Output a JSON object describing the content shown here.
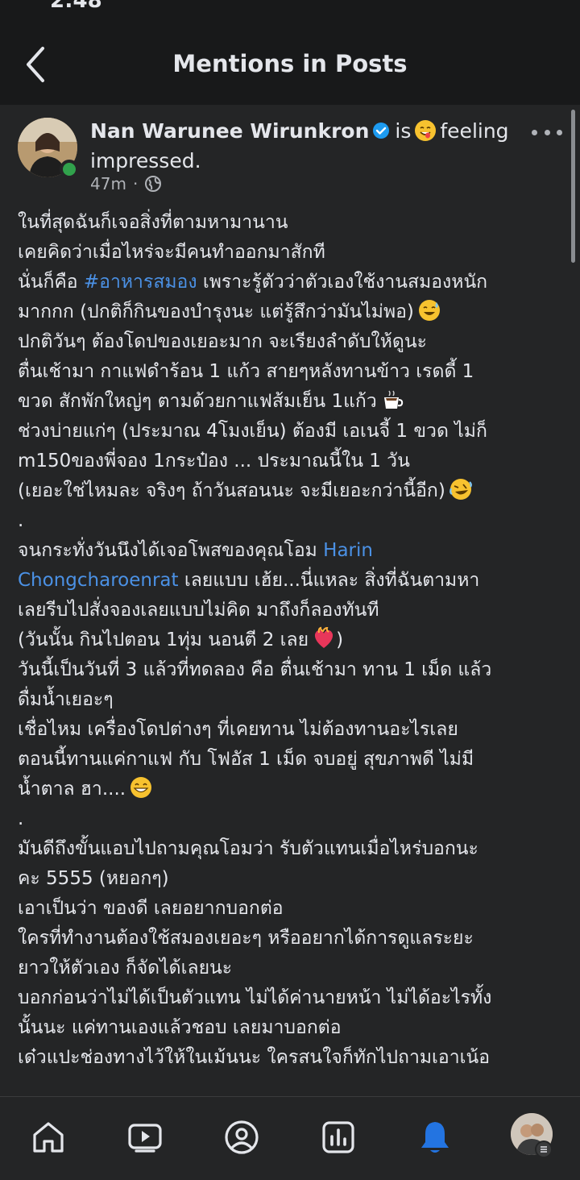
{
  "status_bar": {
    "time": "2:48"
  },
  "header": {
    "title": "Mentions in Posts",
    "back_icon": "chevron-left-icon"
  },
  "post": {
    "author": "Nan Warunee Wirunkron",
    "verified": true,
    "feeling_prefix": "is",
    "feeling_text": "feeling",
    "feeling_value": "impressed.",
    "time_ago": "47m",
    "separator": "·",
    "privacy_icon": "globe-icon",
    "more_icon": "more-horizontal-icon",
    "lines": [
      [
        {
          "t": "ในที่สุดฉันก็เจอสิ่งที่ตามหามานาน"
        }
      ],
      [
        {
          "t": "เคยคิดว่าเมื่อไหร่จะมีคนทำออกมาสักที"
        }
      ],
      [
        {
          "t": " นั่นก็คือ "
        },
        {
          "t": "#อาหารสมอง",
          "link": true
        },
        {
          "t": " เพราะรู้ตัวว่าตัวเองใช้งานสมองหนัก"
        }
      ],
      [
        {
          "t": "มากกก (ปกติก็กินของบำรุงนะ แต่รู้สึกว่ามันไม่พอ)"
        },
        {
          "emoji": "sweat-smile"
        }
      ],
      [
        {
          "t": "ปกติวันๆ ต้องโดปของเยอะมาก จะเรียงลำดับให้ดูนะ"
        }
      ],
      [
        {
          "t": "ตื่นเช้ามา กาแฟดำร้อน 1 แก้ว  สายๆหลังทานข้าว เรดดี้ 1"
        }
      ],
      [
        {
          "t": "ขวด สักพักใหญ่ๆ ตามด้วยกาแฟส้มเย็น 1แก้ว"
        },
        {
          "emoji": "coffee"
        }
      ],
      [
        {
          "t": "ช่วงบ่ายแก่ๆ (ประมาณ 4โมงเย็น) ต้องมี เอเนจี้ 1 ขวด ไม่ก็"
        }
      ],
      [
        {
          "t": "m150ของพี่จอง 1กระป๋อง ... ประมาณนี้ใน 1 วัน"
        }
      ],
      [
        {
          "t": "(เยอะใช่ไหมละ จริงๆ ถ้าวันสอนนะ จะมีเยอะกว่านี้อีก)"
        },
        {
          "emoji": "rofl"
        }
      ],
      [
        {
          "t": "."
        }
      ],
      [
        {
          "t": "จนกระทั่งวันนึงได้เจอโพสของคุณโอม "
        },
        {
          "t": "Harin",
          "link": true
        }
      ],
      [
        {
          "t": "Chongcharoenrat",
          "link": true
        },
        {
          "t": " เลยแบบ เฮ้ย...นี่แหละ สิ่งที่ฉันตามหา"
        }
      ],
      [
        {
          "t": "เลยรีบไปสั่งจองเลยแบบไม่คิด มาถึงก็ลองทันที"
        }
      ],
      [
        {
          "t": "(วันนั้น กินไปตอน 1ทุ่ม นอนตี 2 เลย"
        },
        {
          "emoji": "heart-fire"
        },
        {
          "t": ")"
        }
      ],
      [
        {
          "t": "วันนี้เป็นวันที่ 3 แล้วที่ทดลอง คือ ตื่นเช้ามา ทาน 1 เม็ด แล้ว"
        }
      ],
      [
        {
          "t": "ดื่มน้ำเยอะๆ"
        }
      ],
      [
        {
          "t": "เชื่อไหม เครื่องโดปต่างๆ ที่เคยทาน ไม่ต้องทานอะไรเลย"
        }
      ],
      [
        {
          "t": "ตอนนี้ทานแค่กาแฟ กับ โฟอัส 1 เม็ด จบอยู่ สุขภาพดี ไม่มี"
        }
      ],
      [
        {
          "t": "น้ำตาล ฮา...."
        },
        {
          "emoji": "grin"
        }
      ],
      [
        {
          "t": "."
        }
      ],
      [
        {
          "t": "มันดีถึงขั้นแอบไปถามคุณโอมว่า รับตัวแทนเมื่อไหร่บอกนะ"
        }
      ],
      [
        {
          "t": "คะ 5555 (หยอกๆ)"
        }
      ],
      [
        {
          "t": "เอาเป็นว่า ของดี เลยอยากบอกต่อ"
        }
      ],
      [
        {
          "t": "ใครที่ทำงานต้องใช้สมองเยอะๆ หรืออยากได้การดูแลระยะ"
        }
      ],
      [
        {
          "t": "ยาวให้ตัวเอง ก็จัดได้เลยนะ"
        }
      ],
      [
        {
          "t": "บอกก่อนว่าไม่ได้เป็นตัวแทน ไม่ได้ค่านายหน้า ไม่ได้อะไรทั้ง"
        }
      ],
      [
        {
          "t": "นั้นนะ แค่ทานเองแล้วชอบ เลยมาบอกต่อ"
        }
      ],
      [
        {
          "t": "เด๋วแปะช่องทางไว้ให้ในเม้นนะ ใครสนใจก็ทักไปถามเอาเน้อ"
        }
      ]
    ]
  },
  "nav": {
    "items": [
      {
        "name": "home",
        "icon": "home-icon"
      },
      {
        "name": "video",
        "icon": "video-icon"
      },
      {
        "name": "profile",
        "icon": "profile-icon"
      },
      {
        "name": "dashboard",
        "icon": "dashboard-icon"
      },
      {
        "name": "notifications",
        "icon": "bell-icon",
        "active": true
      },
      {
        "name": "menu",
        "icon": "menu-avatar-icon"
      }
    ],
    "active_color": "#2374e1"
  },
  "colors": {
    "background": "#242526",
    "header": "#18191a",
    "text": "#e4e6eb",
    "secondary": "#b0b3b8",
    "link": "#4b91e5",
    "online": "#31a24c",
    "verified": "#1d9bf0"
  }
}
